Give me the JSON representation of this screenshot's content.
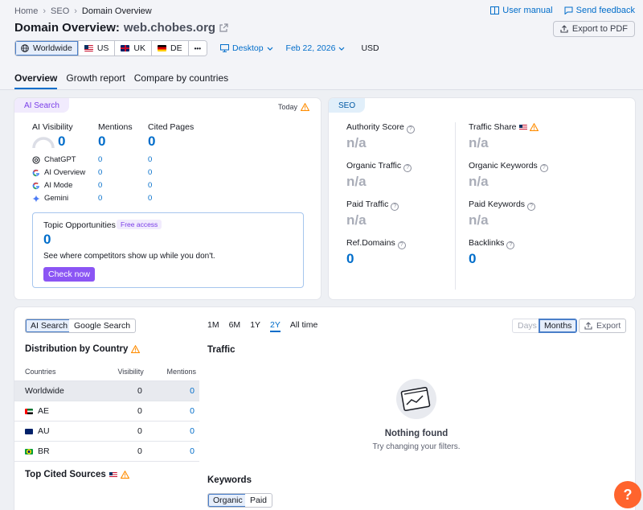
{
  "breadcrumbs": [
    "Home",
    "SEO",
    "Domain Overview"
  ],
  "header": {
    "title_prefix": "Domain Overview:",
    "domain": "web.chobes.org",
    "user_manual": "User manual",
    "send_feedback": "Send feedback",
    "export_pdf": "Export to PDF"
  },
  "filters": {
    "regions": [
      {
        "label": "Worldwide",
        "icon": "globe-icon"
      },
      {
        "label": "US",
        "icon": "us-flag"
      },
      {
        "label": "UK",
        "icon": "uk-flag"
      },
      {
        "label": "DE",
        "icon": "de-flag"
      }
    ],
    "more": "•••",
    "device": "Desktop",
    "date": "Feb 22, 2026",
    "currency": "USD"
  },
  "tabs": [
    "Overview",
    "Growth report",
    "Compare by countries"
  ],
  "ai_card": {
    "pill": "AI Search",
    "today": "Today",
    "cols": [
      "AI Visibility",
      "Mentions",
      "Cited Pages"
    ],
    "totals": [
      "0",
      "0",
      "0"
    ],
    "sources": [
      {
        "name": "ChatGPT",
        "icon": "chatgpt-icon",
        "mentions": "0",
        "cited": "0"
      },
      {
        "name": "AI Overview",
        "icon": "google-icon",
        "mentions": "0",
        "cited": "0"
      },
      {
        "name": "AI Mode",
        "icon": "google-icon",
        "mentions": "0",
        "cited": "0"
      },
      {
        "name": "Gemini",
        "icon": "gemini-icon",
        "mentions": "0",
        "cited": "0"
      }
    ],
    "topic": {
      "title": "Topic Opportunities",
      "badge": "Free access",
      "value": "0",
      "desc": "See where competitors show up while you don't.",
      "button": "Check now"
    }
  },
  "seo_card": {
    "pill": "SEO",
    "metrics": [
      {
        "label": "Authority Score",
        "value": "n/a"
      },
      {
        "label": "Traffic Share",
        "value": "n/a"
      },
      {
        "label": "Organic Traffic",
        "value": "n/a"
      },
      {
        "label": "Organic Keywords",
        "value": "n/a"
      },
      {
        "label": "Paid Traffic",
        "value": "n/a"
      },
      {
        "label": "Paid Keywords",
        "value": "n/a"
      },
      {
        "label": "Ref.Domains",
        "value": "0"
      },
      {
        "label": "Backlinks",
        "value": "0"
      }
    ]
  },
  "bottom": {
    "search_toggle": [
      "AI Search",
      "Google Search"
    ],
    "periods": [
      "1M",
      "6M",
      "1Y",
      "2Y",
      "All time"
    ],
    "granularity": [
      "Days",
      "Months"
    ],
    "export": "Export",
    "distribution_title": "Distribution by Country",
    "table_headers": [
      "Countries",
      "Visibility",
      "Mentions"
    ],
    "rows": [
      {
        "country": "Worldwide",
        "visibility": "0",
        "mentions": "0"
      },
      {
        "country": "AE",
        "visibility": "0",
        "mentions": "0"
      },
      {
        "country": "AU",
        "visibility": "0",
        "mentions": "0"
      },
      {
        "country": "BR",
        "visibility": "0",
        "mentions": "0"
      }
    ],
    "traffic_title": "Traffic",
    "nothing_found": "Nothing found",
    "try_changing": "Try changing your filters.",
    "top_cited": "Top Cited Sources",
    "keywords_title": "Keywords",
    "keyword_toggle": [
      "Organic",
      "Paid"
    ]
  },
  "help": "?"
}
